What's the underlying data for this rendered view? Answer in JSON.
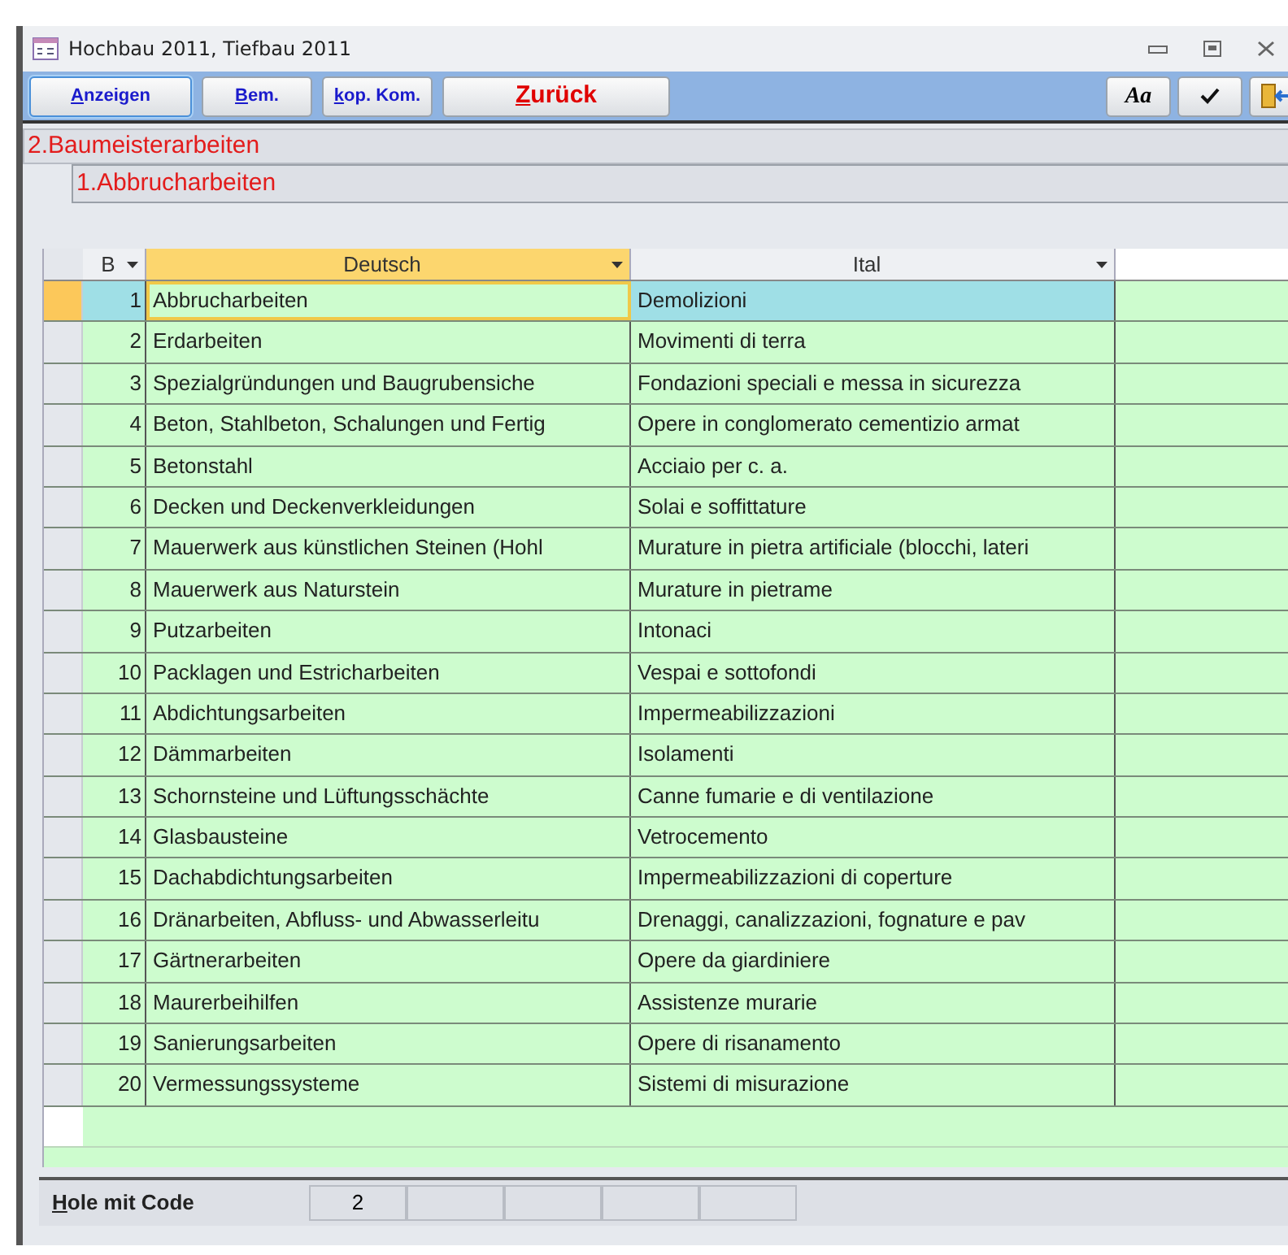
{
  "window": {
    "title": "Hochbau 2011, Tiefbau 2011"
  },
  "toolbar": {
    "buttons": [
      {
        "label": "Anzeigen",
        "kind": "focused"
      },
      {
        "label": "Bem.",
        "kind": "normal"
      },
      {
        "label": "kop. Kom.",
        "kind": "normal"
      },
      {
        "label": "Zurück",
        "kind": "alert"
      }
    ],
    "font_button": "Aa"
  },
  "breadcrumb": [
    "2.Baumeisterarbeiten",
    "1.Abbrucharbeiten"
  ],
  "table": {
    "columns": [
      {
        "label": "B",
        "active": false
      },
      {
        "label": "Deutsch",
        "active": true
      },
      {
        "label": "Ital",
        "active": false
      }
    ],
    "rows": [
      {
        "b": "1",
        "deutsch": "Abbrucharbeiten",
        "ital": "Demolizioni",
        "selected": true
      },
      {
        "b": "2",
        "deutsch": "Erdarbeiten",
        "ital": "Movimenti di terra",
        "selected": false
      },
      {
        "b": "3",
        "deutsch": "Spezialgründungen und Baugrubensiche",
        "ital": "Fondazioni speciali e messa in sicurezza",
        "selected": false
      },
      {
        "b": "4",
        "deutsch": "Beton, Stahlbeton, Schalungen und Fertig",
        "ital": "Opere in conglomerato cementizio armat",
        "selected": false
      },
      {
        "b": "5",
        "deutsch": "Betonstahl",
        "ital": "Acciaio per c. a.",
        "selected": false
      },
      {
        "b": "6",
        "deutsch": "Decken und Deckenverkleidungen",
        "ital": "Solai e soffittature",
        "selected": false
      },
      {
        "b": "7",
        "deutsch": "Mauerwerk aus künstlichen Steinen (Hohl",
        "ital": "Murature in pietra artificiale (blocchi, lateri",
        "selected": false
      },
      {
        "b": "8",
        "deutsch": "Mauerwerk aus Naturstein",
        "ital": "Murature in pietrame",
        "selected": false
      },
      {
        "b": "9",
        "deutsch": "Putzarbeiten",
        "ital": "Intonaci",
        "selected": false
      },
      {
        "b": "10",
        "deutsch": "Packlagen und Estricharbeiten",
        "ital": "Vespai e sottofondi",
        "selected": false
      },
      {
        "b": "11",
        "deutsch": "Abdichtungsarbeiten",
        "ital": "Impermeabilizzazioni",
        "selected": false
      },
      {
        "b": "12",
        "deutsch": "Dämmarbeiten",
        "ital": "Isolamenti",
        "selected": false
      },
      {
        "b": "13",
        "deutsch": "Schornsteine und Lüftungsschächte",
        "ital": "Canne fumarie e di ventilazione",
        "selected": false
      },
      {
        "b": "14",
        "deutsch": "Glasbausteine",
        "ital": "Vetrocemento",
        "selected": false
      },
      {
        "b": "15",
        "deutsch": "Dachabdichtungsarbeiten",
        "ital": "Impermeabilizzazioni di coperture",
        "selected": false
      },
      {
        "b": "16",
        "deutsch": "Dränarbeiten, Abfluss- und Abwasserleitu",
        "ital": "Drenaggi, canalizzazioni, fognature e pav",
        "selected": false
      },
      {
        "b": "17",
        "deutsch": "Gärtnerarbeiten",
        "ital": "Opere da giardiniere",
        "selected": false
      },
      {
        "b": "18",
        "deutsch": "Maurerbeihilfen",
        "ital": "Assistenze murarie",
        "selected": false
      },
      {
        "b": "19",
        "deutsch": "Sanierungsarbeiten",
        "ital": "Opere di risanamento",
        "selected": false
      },
      {
        "b": "20",
        "deutsch": "Vermessungssysteme",
        "ital": "Sistemi di misurazione",
        "selected": false
      }
    ]
  },
  "status_bar": {
    "label": "Hole mit Code",
    "code": "2"
  }
}
